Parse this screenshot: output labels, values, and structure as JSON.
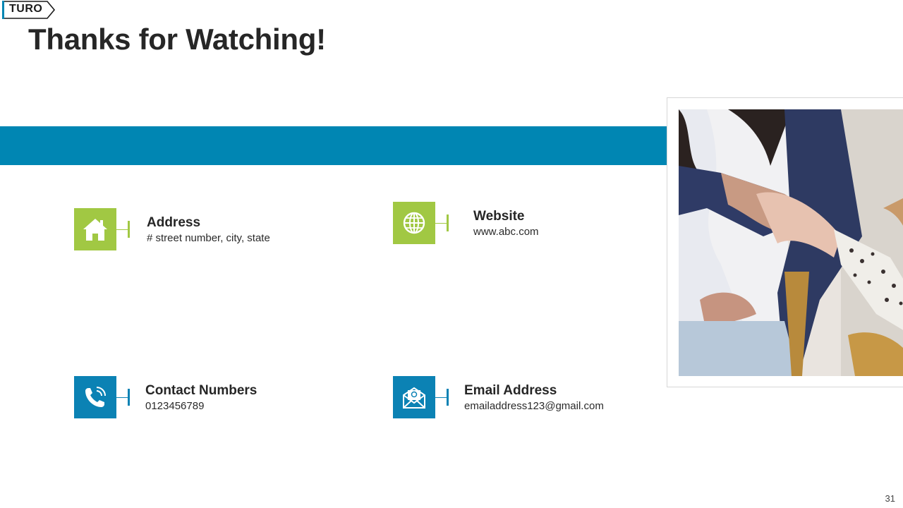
{
  "logo": {
    "text": "TURO"
  },
  "title": "Thanks for Watching!",
  "contacts": {
    "address": {
      "label": "Address",
      "value": "# street number, city, state",
      "icon": "home-icon"
    },
    "website": {
      "label": "Website",
      "value": "www.abc.com",
      "icon": "globe-icon"
    },
    "phone": {
      "label": "Contact Numbers",
      "value": "0123456789",
      "icon": "phone-icon"
    },
    "email": {
      "label": "Email Address",
      "value": "emailaddress123@gmail.com",
      "icon": "email-icon"
    }
  },
  "colors": {
    "accent_blue": "#0086b3",
    "accent_green": "#a1c843"
  },
  "page_number": "31"
}
